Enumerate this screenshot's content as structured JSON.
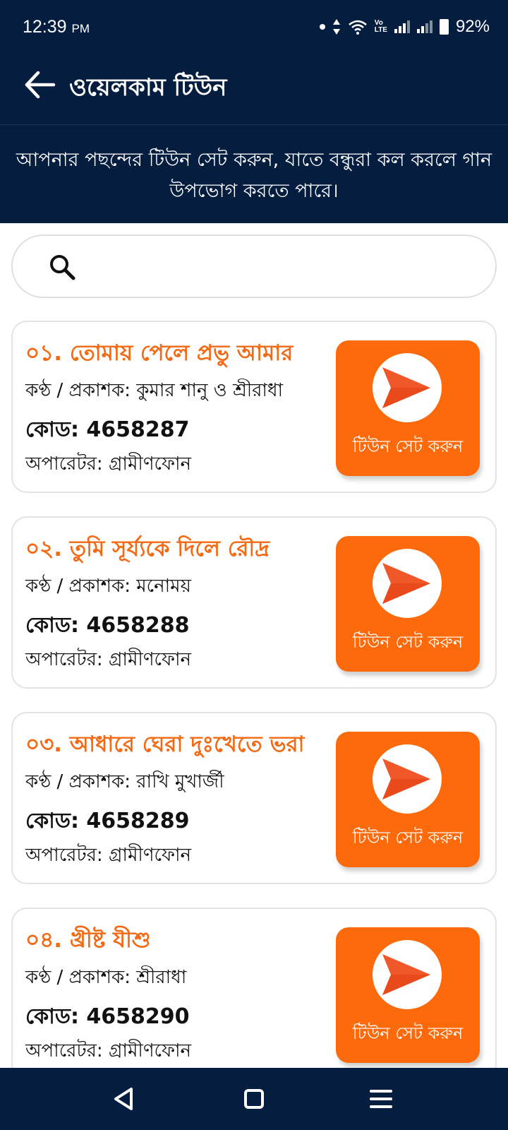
{
  "status_bar": {
    "time": "12:39",
    "ampm": "PM",
    "battery": "92%"
  },
  "header": {
    "title": "ওয়েলকাম টিউন"
  },
  "banner": {
    "text": "আপনার পছন্দের টিউন সেট করুন, যাতে বন্ধুরা কল করলে গান উপভোগ করতে পারে।"
  },
  "search": {
    "placeholder": ""
  },
  "songs": [
    {
      "title": "০১. তোমায় পেলে প্রভু আমার",
      "artist": "কণ্ঠ / প্রকাশক: কুমার শানু ও শ্রীরাধা",
      "code": "কোড: 4658287",
      "operator": "অপারেটর: গ্রামীণফোন",
      "button": "টিউন সেট করুন"
    },
    {
      "title": "০২. তুমি সূর্য্যকে দিলে রৌদ্র",
      "artist": "কণ্ঠ / প্রকাশক: মনোময়",
      "code": "কোড: 4658288",
      "operator": "অপারেটর: গ্রামীণফোন",
      "button": "টিউন সেট করুন"
    },
    {
      "title": "০৩. আধারে ঘেরা দুঃখেতে ভরা",
      "artist": "কণ্ঠ / প্রকাশক: রাখি মুখার্জী",
      "code": "কোড: 4658289",
      "operator": "অপারেটর: গ্রামীণফোন",
      "button": "টিউন সেট করুন"
    },
    {
      "title": "০৪. খ্রীষ্ট যীশু",
      "artist": "কণ্ঠ / প্রকাশক: শ্রীরাধা",
      "code": "কোড: 4658290",
      "operator": "অপারেটর: গ্রামীণফোন",
      "button": "টিউন সেট করুন"
    }
  ],
  "colors": {
    "header_bg": "#051e3f",
    "accent": "#fd6a0b",
    "title_orange": "#f46a14"
  },
  "icons": {
    "back": "arrow-left-icon",
    "search": "search-icon",
    "set_tune": "send-arrow-icon",
    "nav_back": "triangle-back-icon",
    "nav_home": "square-home-icon",
    "nav_menu": "menu-icon"
  }
}
